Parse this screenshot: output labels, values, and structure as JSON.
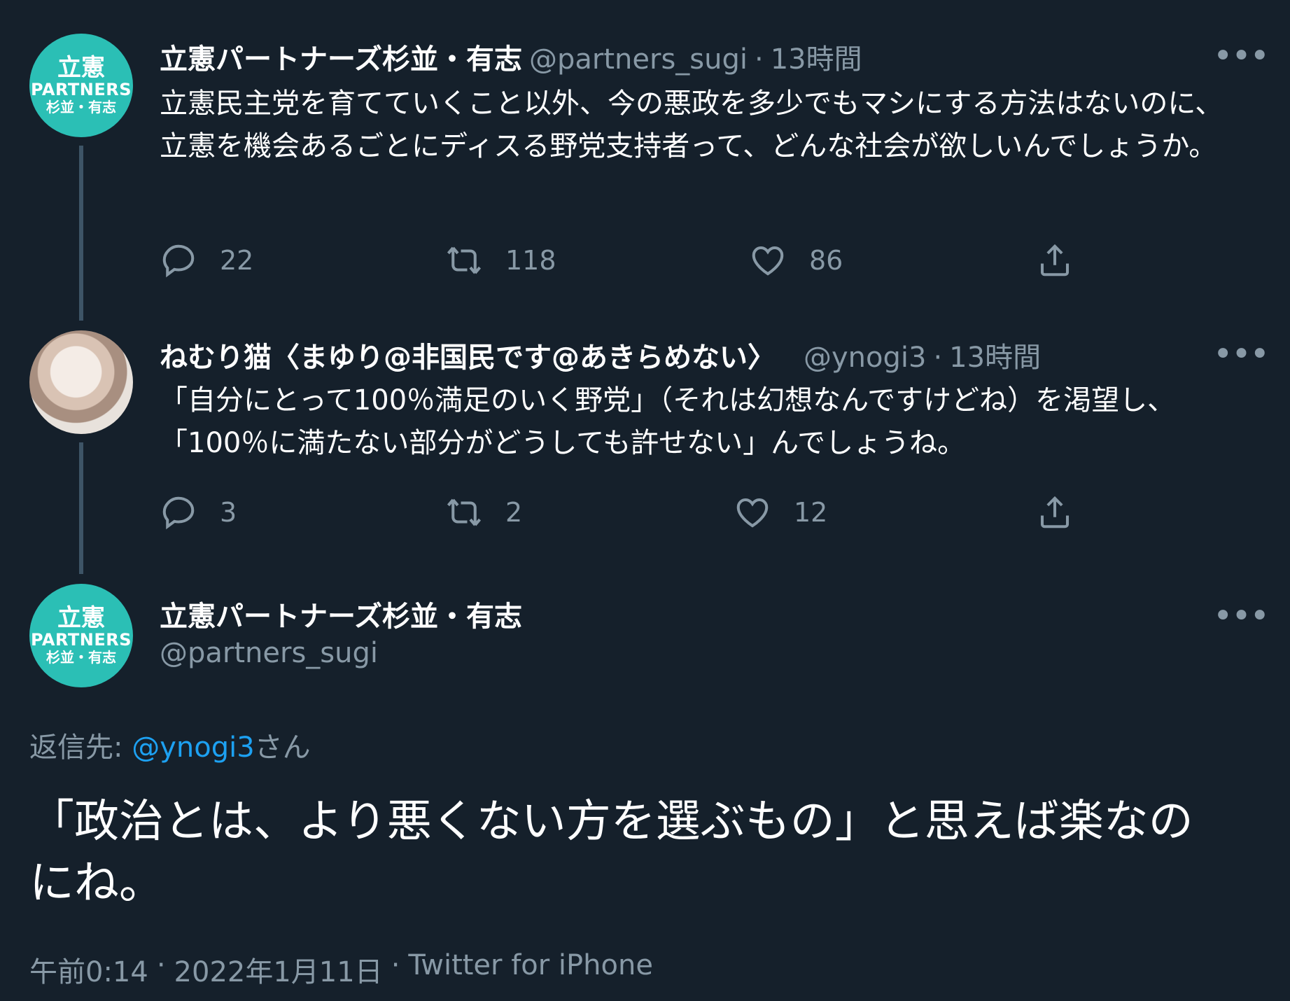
{
  "tweets": [
    {
      "avatar": {
        "main": "立憲",
        "brand": "PARTNERS",
        "sub": "杉並・有志"
      },
      "name": "立憲パートナーズ杉並・有志",
      "handle": "@partners_sugi",
      "separator": "·",
      "time": "13時間",
      "text": "立憲民主党を育てていくこと以外、今の悪政を多少でもマシにする方法はないのに、立憲を機会あるごとにディスる野党支持者って、どんな社会が欲しいんでしょうか。",
      "replies": "22",
      "retweets": "118",
      "likes": "86"
    },
    {
      "name": "ねむり猫〈まゆり@非国民です@あきらめない〉",
      "handle": "@ynogi3",
      "separator": "·",
      "time": "13時間",
      "text": "「自分にとって100％満足のいく野党」（それは幻想なんですけどね）を渇望し、「100％に満たない部分がどうしても許せない」んでしょうね。",
      "replies": "3",
      "retweets": "2",
      "likes": "12"
    }
  ],
  "main_tweet": {
    "avatar": {
      "main": "立憲",
      "brand": "PARTNERS",
      "sub": "杉並・有志"
    },
    "name": "立憲パートナーズ杉並・有志",
    "handle": "@partners_sugi",
    "reply_prefix": "返信先: ",
    "reply_handle": "@ynogi3",
    "reply_suffix": "さん",
    "text": "「政治とは、より悪くない方を選ぶもの」と思えば楽なのにね。",
    "time": "午前0:14",
    "separator": "·",
    "date": "2022年1月11日",
    "source": "Twitter for iPhone"
  },
  "more_label": "•••",
  "icons": [
    "reply-icon",
    "retweet-icon",
    "like-icon",
    "share-icon",
    "more-icon"
  ],
  "colors": {
    "background": "#15202b",
    "muted": "#8899a6",
    "link": "#1da1f2",
    "avatar": "#2bbfb5",
    "thread_line": "#3d5466"
  }
}
